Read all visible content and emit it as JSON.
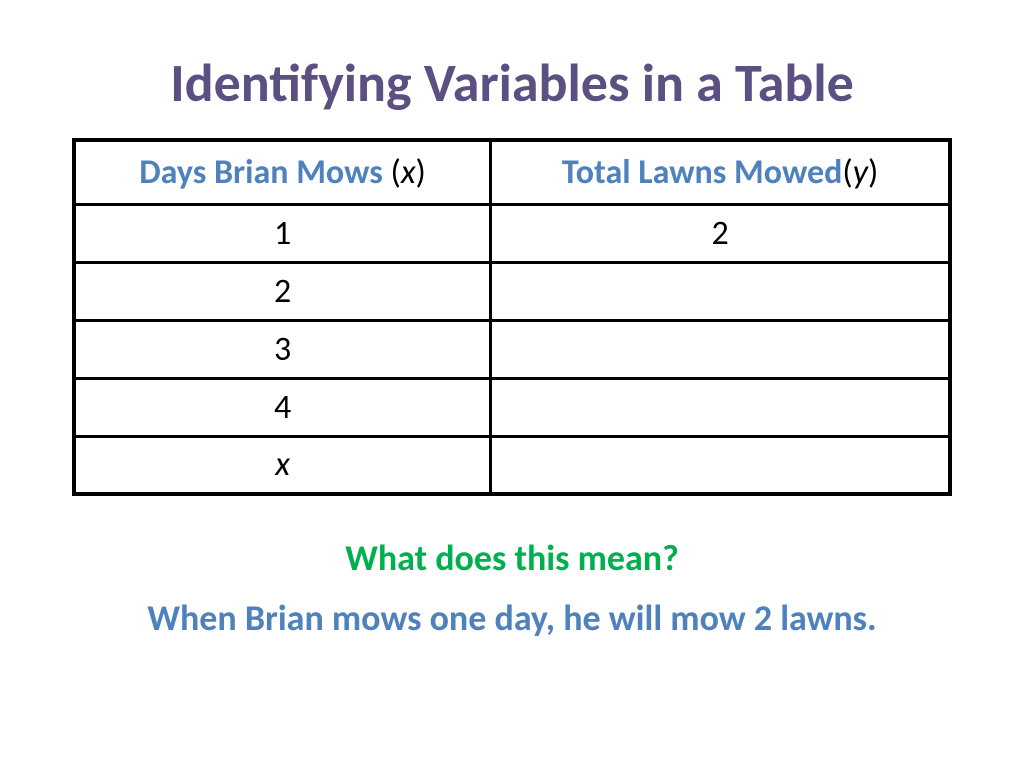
{
  "title": "Identifying Variables in a Table",
  "chart_data": {
    "type": "table",
    "columns": [
      {
        "label": "Days Brian Mows",
        "var_open": "(",
        "var_letter": "x",
        "var_close": ")"
      },
      {
        "label": "Total Lawns Mowed",
        "var_open": "(",
        "var_letter": "y",
        "var_close": ")"
      }
    ],
    "rows": [
      {
        "x": "1",
        "y": "2",
        "x_italic": false
      },
      {
        "x": "2",
        "y": "",
        "x_italic": false
      },
      {
        "x": "3",
        "y": "",
        "x_italic": false
      },
      {
        "x": "4",
        "y": "",
        "x_italic": false
      },
      {
        "x": "x",
        "y": "",
        "x_italic": true
      }
    ]
  },
  "question": "What does this mean?",
  "answer": "When Brian mows one day, he will mow 2 lawns."
}
